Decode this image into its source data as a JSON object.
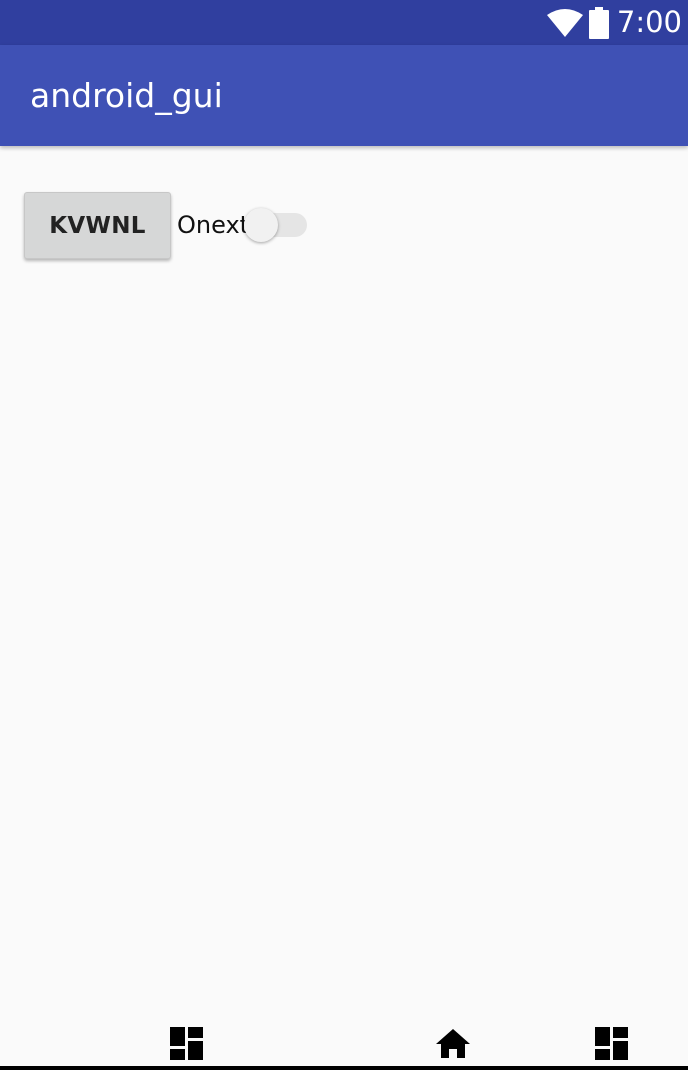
{
  "status_bar": {
    "time": "7:00",
    "icons": [
      "wifi-icon",
      "battery-icon"
    ],
    "background": "#303f9f"
  },
  "app_bar": {
    "title": "android_gui",
    "background": "#3f51b5"
  },
  "content": {
    "button_label": "KVWNL",
    "switch_label": "Onext",
    "switch_on": false
  },
  "nav_bar": {
    "icons": [
      "dashboard-icon",
      "home-icon",
      "dashboard-icon"
    ]
  }
}
